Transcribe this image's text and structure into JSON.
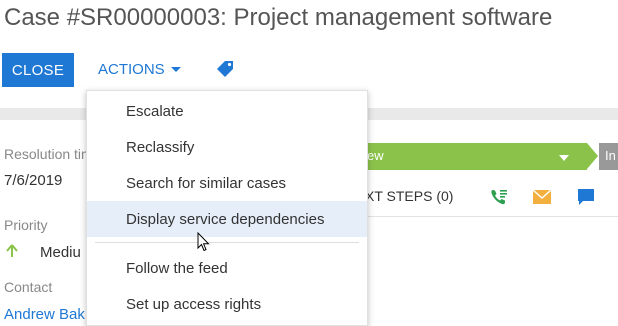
{
  "page": {
    "title": "Case #SR00000003: Project management software"
  },
  "toolbar": {
    "close_label": "CLOSE",
    "actions_label": "ACTIONS"
  },
  "actions_menu": {
    "items": [
      {
        "label": "Escalate"
      },
      {
        "label": "Reclassify"
      },
      {
        "label": "Search for similar cases"
      },
      {
        "label": "Display service dependencies",
        "hovered": true
      },
      {
        "label": "Follow the feed"
      },
      {
        "label": "Set up access rights"
      }
    ]
  },
  "fields": {
    "resolution_time": {
      "label": "Resolution tim",
      "value": "7/6/2019"
    },
    "priority": {
      "label": "Priority",
      "value": "Mediu"
    },
    "contact": {
      "label": "Contact",
      "value": "Andrew Bak"
    }
  },
  "stages": {
    "current": "ew",
    "next": "In"
  },
  "next_steps": {
    "label": "XT STEPS (0)"
  },
  "colors": {
    "accent": "#1e78d4",
    "stage_active": "#8bc34a",
    "stage_inactive": "#999999",
    "hover": "#e6eef9"
  },
  "icons": [
    "tag-icon",
    "up-arrow-icon",
    "phone-icon",
    "mail-icon",
    "chat-icon",
    "cursor-icon"
  ]
}
